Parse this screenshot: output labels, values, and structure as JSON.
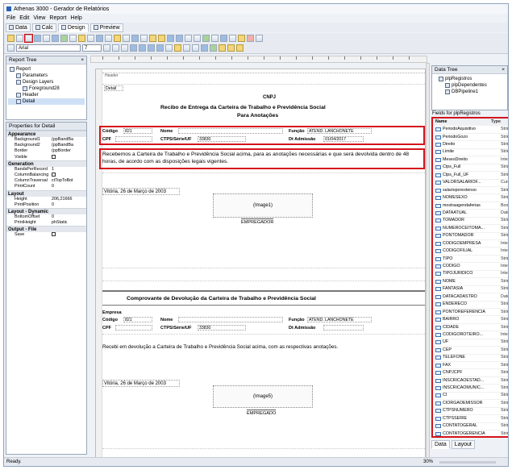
{
  "window": {
    "title": "Athenas 3000 - Gerador de Relatórios"
  },
  "menu": [
    "File",
    "Edit",
    "View",
    "Report",
    "Help"
  ],
  "tabs": [
    {
      "label": "Data"
    },
    {
      "label": "Calc"
    },
    {
      "label": "Design"
    },
    {
      "label": "Preview"
    }
  ],
  "toolbar": {
    "font_name": "Arial",
    "font_size": "7",
    "zoom": "100%"
  },
  "report_tree": {
    "title": "Report Tree",
    "items": [
      {
        "label": "Report",
        "level": 0
      },
      {
        "label": "Parameters",
        "level": 1
      },
      {
        "label": "Design Layers",
        "level": 1
      },
      {
        "label": "Foreground28",
        "level": 2
      },
      {
        "label": "Header",
        "level": 1
      },
      {
        "label": "Detail",
        "level": 1
      }
    ]
  },
  "properties": {
    "title": "Properties for Detail",
    "groups": [
      {
        "name": "Appearance",
        "rows": [
          {
            "k": "Background1",
            "v": "(ppBandBa"
          },
          {
            "k": "Background2",
            "v": "(ppBandBa"
          },
          {
            "k": "Border",
            "v": "(ppBorder"
          },
          {
            "k": "Visible",
            "v": "check"
          }
        ]
      },
      {
        "name": "Generation",
        "rows": [
          {
            "k": "BandsPerRecord",
            "v": "1"
          },
          {
            "k": "ColumnBalancing",
            "v": "check"
          },
          {
            "k": "ColumnTraversal",
            "v": "ctTopToBot"
          },
          {
            "k": "PrintCount",
            "v": "0"
          }
        ]
      },
      {
        "name": "Layout",
        "rows": [
          {
            "k": "Height",
            "v": "206,21666"
          },
          {
            "k": "PrintPosition",
            "v": "0"
          }
        ]
      },
      {
        "name": "Layout - Dynamic",
        "rows": [
          {
            "k": "BottomOffset",
            "v": "0"
          },
          {
            "k": "PrintHeight",
            "v": "phStatic"
          }
        ]
      },
      {
        "name": "Output - File",
        "rows": [
          {
            "k": "Save",
            "v": "check"
          }
        ]
      }
    ]
  },
  "report": {
    "header_band": "Header",
    "detail_label": "Detail",
    "cnpj": "CNPJ",
    "title1": "Recibo de Entrega da Carteira de Trabalho e Previdência Social",
    "title2": "Para Anotações",
    "codigo_label": "Código",
    "codigo_value": "821",
    "nome_label": "Nome",
    "funcao_label": "Função",
    "funcao_value": "ATEND. LANCHONETE",
    "cpf_label": "CPF",
    "ctps_label": "CTPS/Série/UF",
    "ctps_value": "33830",
    "admissao_label": "Dt Admissão",
    "admissao_value": "01/04/2017",
    "body_text": "Recebemos a Carteira de Trabalho e Previdência Social acima, para as anotações necessárias e que será devolvida dentro de 48 horas, de acordo com as disposições legais vigentes.",
    "place_date1": "Vitória, 26 de Março de 2003",
    "image1": "(Image1)",
    "empregador": "EMPREGADOR",
    "title3": "Comprovante de Devolução da Carteira de Trabalho e Previdência Social",
    "empresa_label": "Empresa",
    "body_text2": "Recebi em devolução a Carteira de Trabalho e Previdência Social acima, com as respectivas anotações.",
    "place_date2": "Vitória, 26 de Março de 2003",
    "image5": "(Image5)",
    "empregado": "EMPREGADO"
  },
  "data_tree": {
    "title": "Data Tree",
    "items": [
      "plpRegistros",
      "plpDependentes",
      "DBPipeline1"
    ]
  },
  "fields": {
    "title": "Fields for plpRegistros",
    "col_name": "Name",
    "col_type": "Type",
    "rows": [
      {
        "n": "PeriodoAquisitivo",
        "t": "Strin"
      },
      {
        "n": "PeriodoGozo",
        "t": "Strin"
      },
      {
        "n": "Direito",
        "t": "Strin"
      },
      {
        "n": "Limite",
        "t": "Strin"
      },
      {
        "n": "MesesDireito",
        "t": "Integ"
      },
      {
        "n": "Ctps_Full",
        "t": "Strin"
      },
      {
        "n": "Ctps_Full_UF",
        "t": "Strin"
      },
      {
        "n": "VALORSALARIOF...",
        "t": "Curre"
      },
      {
        "n": "salarioporextenso",
        "t": "Strin"
      },
      {
        "n": "NOMESEXO",
        "t": "Strin"
      },
      {
        "n": "mostraagendaferias",
        "t": "Book"
      },
      {
        "n": "DATAATUAL",
        "t": "Date"
      },
      {
        "n": "TOMADOR",
        "t": "Strin"
      },
      {
        "n": "NUMEROCEITOMA...",
        "t": "Strin"
      },
      {
        "n": "PONTOMADOR",
        "t": "Strin"
      },
      {
        "n": "CODIGOEMPRESA",
        "t": "Integ"
      },
      {
        "n": "CODIGOFILIAL",
        "t": "Integ"
      },
      {
        "n": "TIPO",
        "t": "Strin"
      },
      {
        "n": "CODIGO",
        "t": "Integ"
      },
      {
        "n": "TIPOJURIDICO",
        "t": "Integ"
      },
      {
        "n": "NOME",
        "t": "Strin"
      },
      {
        "n": "FANTASIA",
        "t": "Strin"
      },
      {
        "n": "DATACADASTRO",
        "t": "Date"
      },
      {
        "n": "ENDERECO",
        "t": "Strin"
      },
      {
        "n": "PONTOREFERENCIA",
        "t": "Strin"
      },
      {
        "n": "BAIRRO",
        "t": "Strin"
      },
      {
        "n": "CIDADE",
        "t": "Strin"
      },
      {
        "n": "CODIGOROTEIRO...",
        "t": "Integ"
      },
      {
        "n": "UF",
        "t": "Strin"
      },
      {
        "n": "CEP",
        "t": "Strin"
      },
      {
        "n": "TELEFONE",
        "t": "Strin"
      },
      {
        "n": "FAX",
        "t": "Strin"
      },
      {
        "n": "CNPJCPF",
        "t": "Strin"
      },
      {
        "n": "INSCRICAOESTAD...",
        "t": "Strin"
      },
      {
        "n": "INSCRICAOMUNIC...",
        "t": "Strin"
      },
      {
        "n": "CI",
        "t": "Strin"
      },
      {
        "n": "CIORGAOEMISSOR",
        "t": "Strin"
      },
      {
        "n": "CTPSNUMERO",
        "t": "Strin"
      },
      {
        "n": "CTPSSERIE",
        "t": "Strin"
      },
      {
        "n": "CONTATOGERAL",
        "t": "Strin"
      },
      {
        "n": "CONTATOGERENCIA",
        "t": "Strin"
      }
    ]
  },
  "right_tabs": [
    "Data",
    "Layout"
  ],
  "status": {
    "left": "Ready.",
    "zoom": "30%"
  }
}
